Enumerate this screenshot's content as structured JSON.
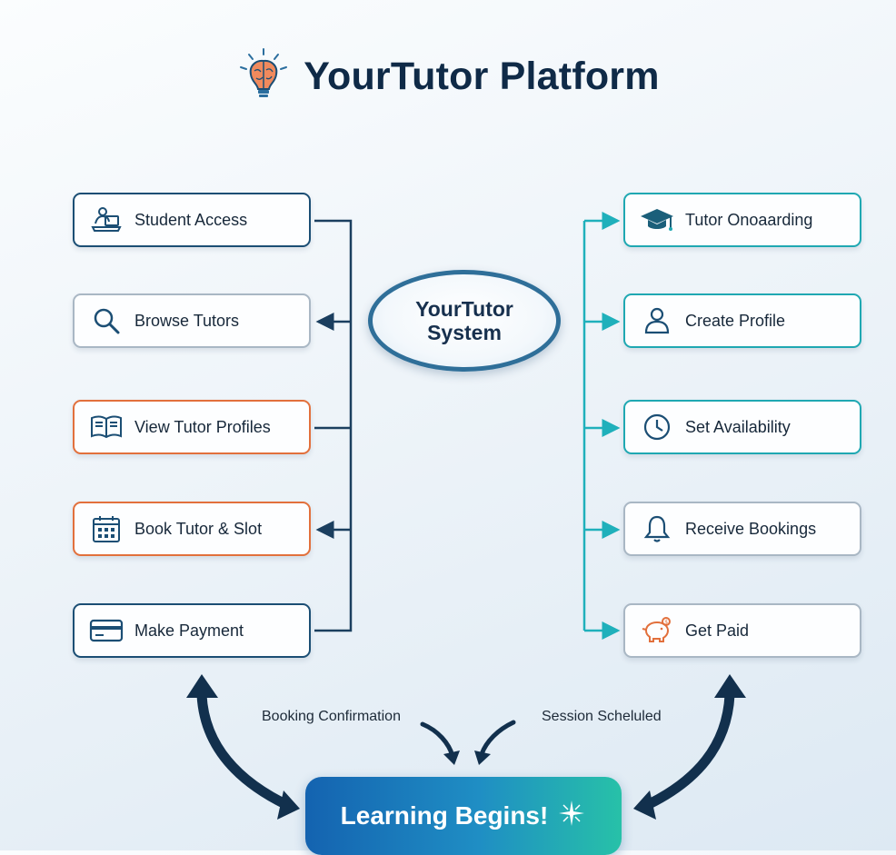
{
  "title": {
    "text": "YourTutor Platform",
    "icon": "brain-lightbulb-icon"
  },
  "center": {
    "line1": "YourTutor",
    "line2": "System"
  },
  "student_steps": [
    {
      "label": "Student Access",
      "icon": "laptop-user-icon",
      "accent": "#1b4e74"
    },
    {
      "label": "Browse Tutors",
      "icon": "search-icon",
      "accent": "#a9b7c4"
    },
    {
      "label": "View Tutor Profiles",
      "icon": "book-icon",
      "accent": "#e2703c"
    },
    {
      "label": "Book Tutor & Slot",
      "icon": "calendar-icon",
      "accent": "#e2703c"
    },
    {
      "label": "Make Payment",
      "icon": "credit-card-icon",
      "accent": "#1b4e74"
    }
  ],
  "tutor_steps": [
    {
      "label": "Tutor Onoaarding",
      "icon": "graduation-cap-icon",
      "accent": "#1fa8b2"
    },
    {
      "label": "Create Profile",
      "icon": "user-icon",
      "accent": "#1fa8b2"
    },
    {
      "label": "Set Availability",
      "icon": "clock-icon",
      "accent": "#1fa8b2"
    },
    {
      "label": "Receive Bookings",
      "icon": "bell-icon",
      "accent": "#a9b7c4"
    },
    {
      "label": "Get Paid",
      "icon": "piggy-bank-icon",
      "accent": "#a9b7c4"
    }
  ],
  "captions": {
    "left": "Booking Confirmation",
    "right": "Session Scheluled"
  },
  "outcome": {
    "label": "Learning Begins!",
    "icon": "sparkle-icon"
  },
  "colors": {
    "navy": "#1b4e74",
    "teal": "#1fa8b2",
    "orange": "#e2703c",
    "title": "#0f2a47"
  }
}
